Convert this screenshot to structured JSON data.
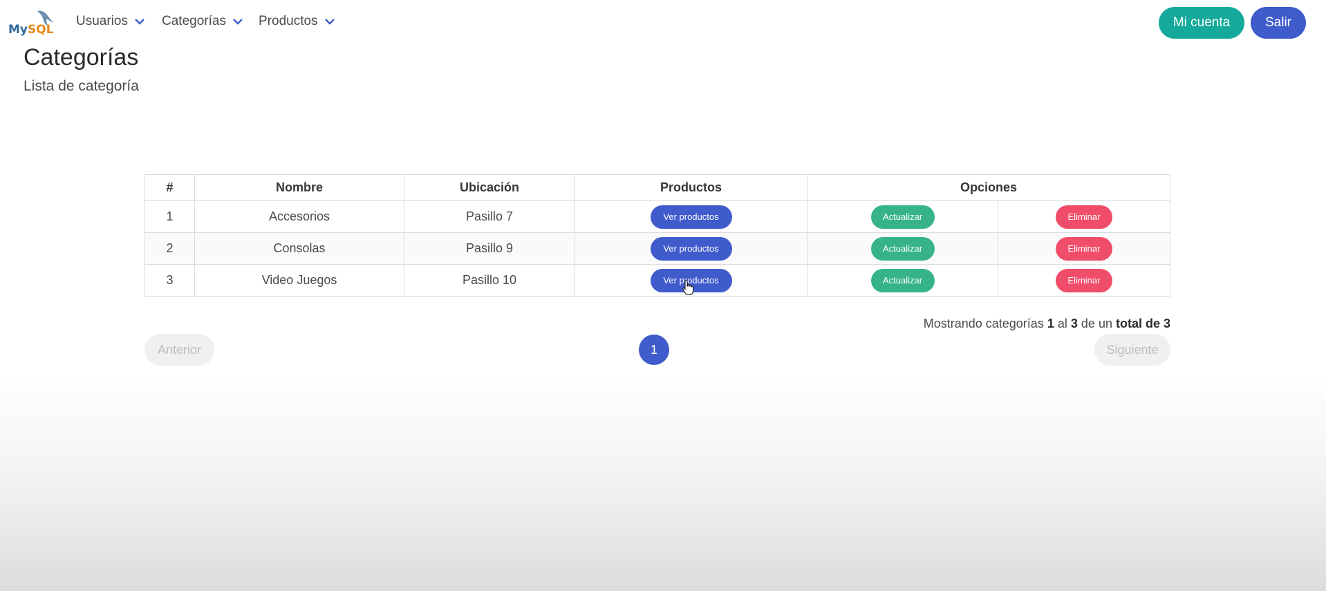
{
  "navbar": {
    "logo_text": "MySQL",
    "menu": [
      {
        "label": "Usuarios"
      },
      {
        "label": "Categorías"
      },
      {
        "label": "Productos"
      }
    ],
    "account_label": "Mi cuenta",
    "exit_label": "Salir"
  },
  "page": {
    "title": "Categorías",
    "subtitle": "Lista de categoría"
  },
  "table": {
    "headers": [
      "#",
      "Nombre",
      "Ubicación",
      "Productos",
      "Opciones"
    ],
    "rows": [
      {
        "num": "1",
        "name": "Accesorios",
        "location": "Pasillo 7",
        "view": "Ver productos",
        "update": "Actualizar",
        "delete": "Eliminar"
      },
      {
        "num": "2",
        "name": "Consolas",
        "location": "Pasillo 9",
        "view": "Ver productos",
        "update": "Actualizar",
        "delete": "Eliminar"
      },
      {
        "num": "3",
        "name": "Video Juegos",
        "location": "Pasillo 10",
        "view": "Ver productos",
        "update": "Actualizar",
        "delete": "Eliminar"
      }
    ]
  },
  "summary": {
    "prefix": "Mostrando categorías",
    "from": "1",
    "middle": "al",
    "to": "3",
    "suffix": "de un",
    "total": "total de 3"
  },
  "pagination": {
    "prev_label": "Anterior",
    "current_page": "1",
    "next_label": "Siguiente"
  },
  "colors": {
    "primary": "#3f5bcc",
    "account": "#14a99a",
    "update": "#36b487",
    "delete": "#f04d6a"
  }
}
